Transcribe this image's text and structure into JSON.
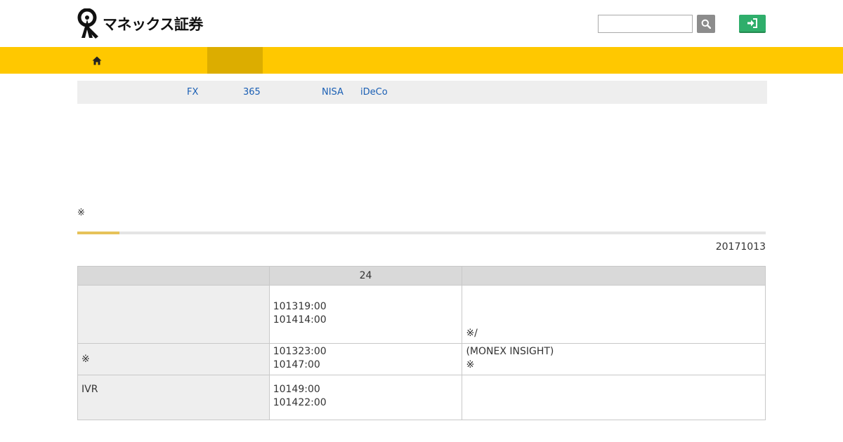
{
  "header": {
    "logo_text": "マネックス証券",
    "search_placeholder": "",
    "search_icon": "search-icon",
    "login_icon": "sign-in-icon"
  },
  "gnav": {
    "home_icon": "home-icon"
  },
  "subnav": {
    "links": [
      "FX",
      "365",
      "NISA",
      "iDeCo"
    ]
  },
  "note": "※",
  "date": "20171013",
  "table": {
    "headers": [
      "",
      "24",
      ""
    ],
    "rows": [
      {
        "label": "",
        "times": [
          "101319:00",
          "101414:00"
        ],
        "notes": [
          "",
          "",
          "※/"
        ]
      },
      {
        "label": "※",
        "times": [
          "101323:00",
          "10147:00"
        ],
        "notes": [
          "(MONEX INSIGHT)",
          "※"
        ]
      },
      {
        "label": "IVR",
        "times": [
          "10149:00",
          "101422:00"
        ],
        "notes": [
          ""
        ]
      }
    ]
  },
  "colors": {
    "brand_yellow": "#ffc800",
    "nav_active": "#dcad00",
    "login_green": "#2fae6b",
    "link_blue": "#1a5fb4"
  }
}
